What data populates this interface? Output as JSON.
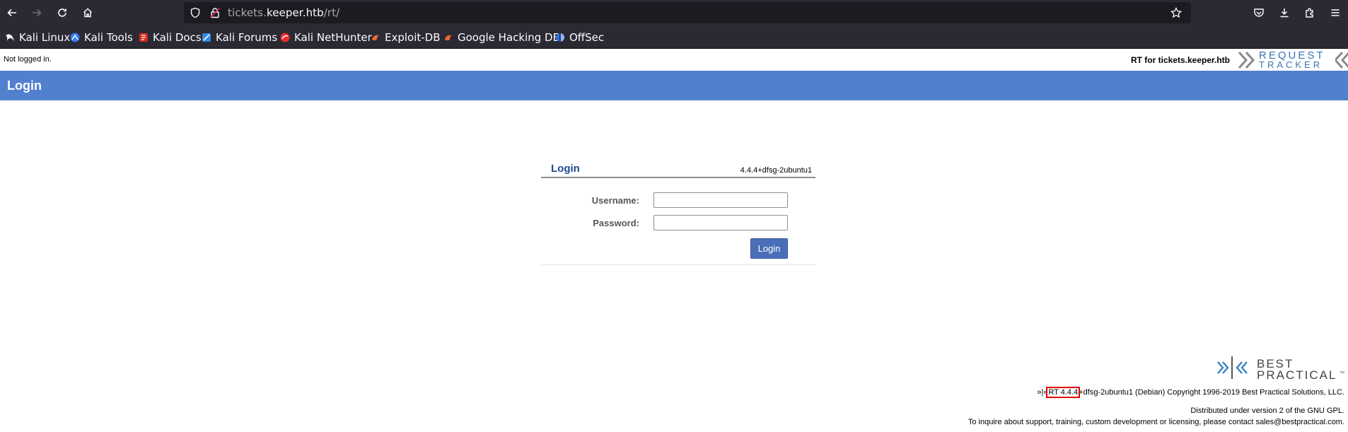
{
  "browser": {
    "url_prefix": "tickets.",
    "url_domain": "keeper.htb",
    "url_path": "/rt/",
    "bookmarks": [
      {
        "label": "Kali Linux",
        "icon": "kali-dragon-icon"
      },
      {
        "label": "Kali Tools",
        "icon": "kali-tools-icon"
      },
      {
        "label": "Kali Docs",
        "icon": "kali-docs-icon"
      },
      {
        "label": "Kali Forums",
        "icon": "kali-forums-icon"
      },
      {
        "label": "Kali NetHunter",
        "icon": "kali-nethunter-icon"
      },
      {
        "label": "Exploit-DB",
        "icon": "exploit-db-icon"
      },
      {
        "label": "Google Hacking DB",
        "icon": "ghdb-icon"
      },
      {
        "label": "OffSec",
        "icon": "offsec-icon"
      }
    ]
  },
  "rt": {
    "login_status": "Not logged in.",
    "instance_label": "RT for tickets.keeper.htb",
    "logo_line1": "REQUEST",
    "logo_line2": "TRACKER",
    "page_title": "Login",
    "login": {
      "title": "Login",
      "version": "4.4.4+dfsg-2ubuntu1",
      "username_label": "Username:",
      "password_label": "Password:",
      "username_value": "",
      "password_value": "",
      "submit_label": "Login"
    },
    "footer": {
      "bp_line1": "BEST",
      "bp_line2": "PRACTICAL",
      "bp_tm": "™",
      "marker": "»|«",
      "version_highlight": "RT 4.4.4",
      "version_rest": "+dfsg-2ubuntu1 (Debian) Copyright 1996-2019 Best Practical Solutions, LLC.",
      "license": "Distributed under version 2 of the GNU GPL.",
      "contact": "To inquire about support, training, custom development or licensing, please contact sales@bestpractical.com."
    }
  },
  "colors": {
    "chrome_bg": "#2b2a33",
    "urlbar_bg": "#1c1b22",
    "title_bar": "#537fcf",
    "login_button": "#4a6fb8",
    "highlight_box": "#e00000"
  }
}
